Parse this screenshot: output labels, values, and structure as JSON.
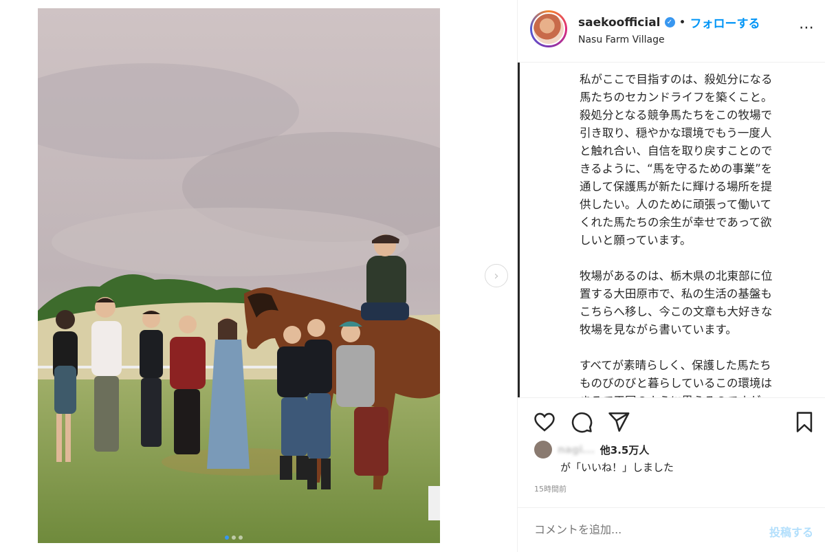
{
  "post": {
    "username": "saekoofficial",
    "separator": "•",
    "follow_label": "フォローする",
    "location": "Nasu Farm Village",
    "more_icon": "more-options-icon",
    "verified_icon": "verified-badge-icon"
  },
  "caption": {
    "text": "私がここで目指すのは、殺処分になる\n馬たちのセカンドライフを築くこと。\n殺処分となる競争馬たちをこの牧場で\n引き取り、穏やかな環境でもう一度人\nと触れ合い、自信を取り戻すことので\nきるように、“馬を守るための事業”を\n通して保護馬が新たに輝ける場所を提\n供したい。人のために頑張って働いて\nくれた馬たちの余生が幸せであって欲\nしいと願っています。\n\n牧場があるのは、栃木県の北東部に位\n置する大田原市で、私の生活の基盤も\nこちらへ移し、今この文章も大好きな\n牧場を見ながら書いています。\n\nすべてが素晴らしく、保護した馬たち\nものびのびと暮らしているこの環境は\nまるで天国のように思えるのですが、\n牧場運営を存続させていくためには"
  },
  "actions": {
    "like_icon": "heart-icon",
    "comment_icon": "comment-icon",
    "share_icon": "share-icon",
    "save_icon": "bookmark-icon"
  },
  "likes": {
    "liker_name": "nagi...",
    "count_text": "他3.5万人",
    "tail_text": "が「いいね！」しました"
  },
  "timestamp": "15時間前",
  "comment": {
    "placeholder": "コメントを追加...",
    "post_label": "投稿する"
  },
  "carousel": {
    "next_icon": "chevron-right-icon",
    "slide_count": 3,
    "active_index": 0
  },
  "colors": {
    "accent": "#0095f6",
    "verified": "#3897f0",
    "muted": "#8e8e8e"
  }
}
